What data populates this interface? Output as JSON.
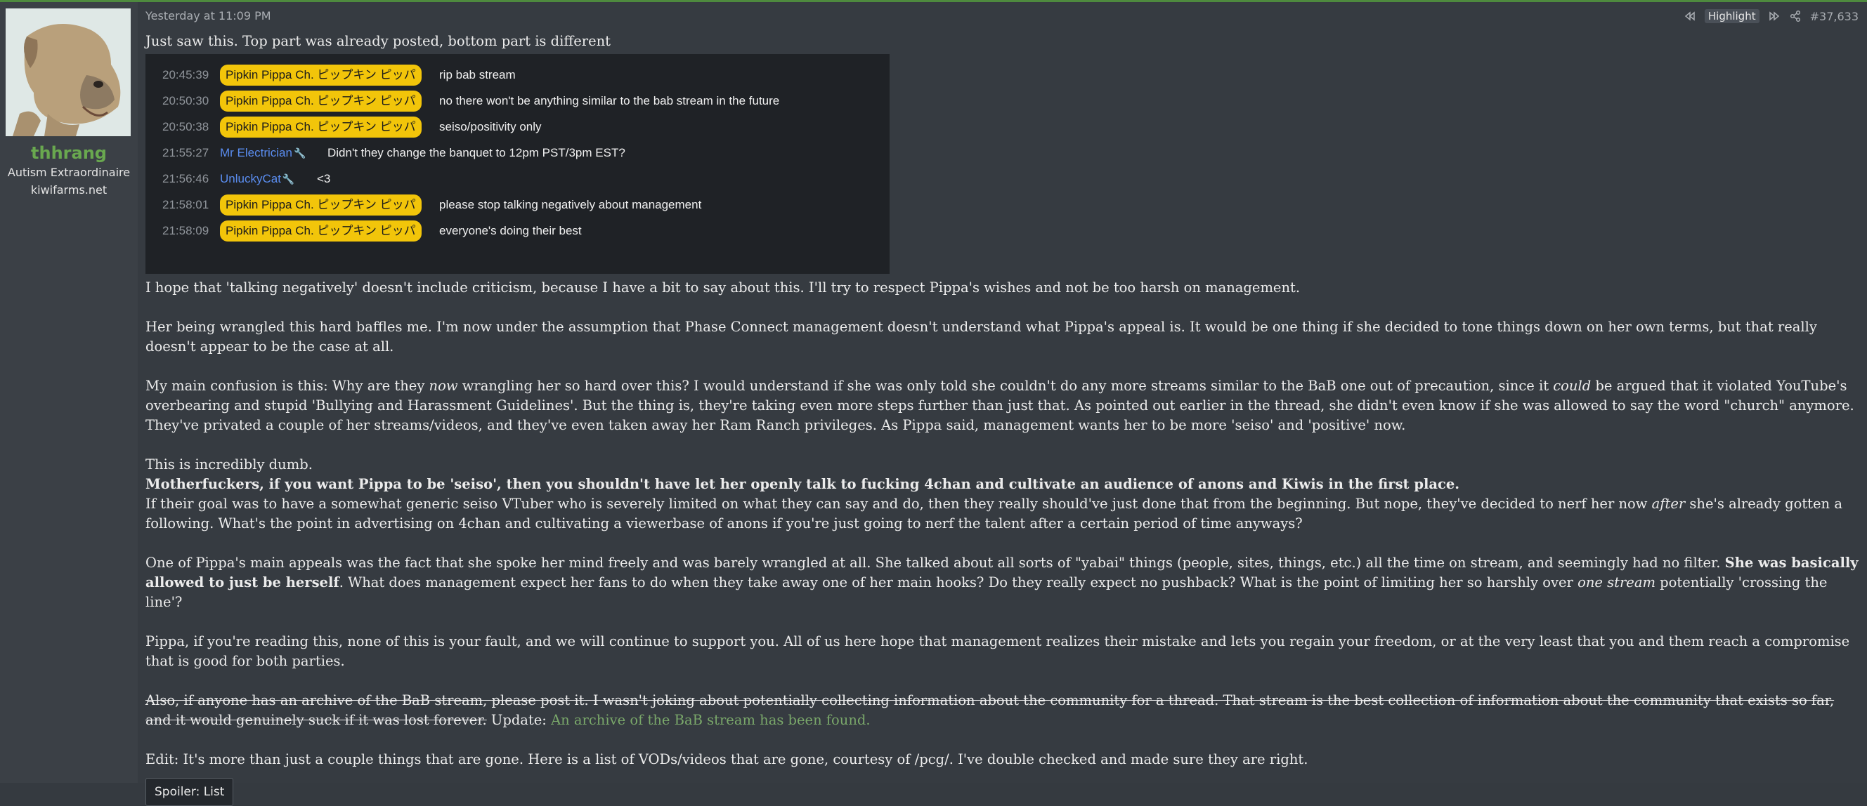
{
  "user": {
    "name": "thhrang",
    "title": "Autism Extraordinaire",
    "banner": "kiwifarms.net"
  },
  "post": {
    "date": "Yesterday at 11:09 PM",
    "highlight_label": "Highlight",
    "post_number": "#37,633",
    "intro": "Just saw this. Top part was already posted, bottom part is different",
    "chat": [
      {
        "time": "20:45:39",
        "name": "Pipkin Pippa Ch. ピップキン ピッパ",
        "badge": true,
        "message": "rip bab stream"
      },
      {
        "time": "20:50:30",
        "name": "Pipkin Pippa Ch. ピップキン ピッパ",
        "badge": true,
        "message": "no there won't be anything similar to the bab stream in the future"
      },
      {
        "time": "20:50:38",
        "name": "Pipkin Pippa Ch. ピップキン ピッパ",
        "badge": true,
        "message": "seiso/positivity only"
      },
      {
        "time": "21:55:27",
        "name": "Mr Electrician",
        "badge": false,
        "message": "Didn't they change the banquet to 12pm PST/3pm EST?"
      },
      {
        "time": "21:56:46",
        "name": "UnluckyCat",
        "badge": false,
        "message": "<3"
      },
      {
        "time": "21:58:01",
        "name": "Pipkin Pippa Ch. ピップキン ピッパ",
        "badge": true,
        "message": "please stop talking negatively about management"
      },
      {
        "time": "21:58:09",
        "name": "Pipkin Pippa Ch. ピップキン ピッパ",
        "badge": true,
        "message": "everyone's doing their best"
      }
    ],
    "p1": "I hope that 'talking negatively' doesn't include criticism, because I have a bit to say about this. I'll try to respect Pippa's wishes and not be too harsh on management.",
    "p2": "Her being wrangled this hard baffles me. I'm now under the assumption that Phase Connect management doesn't understand what Pippa's appeal is. It would be one thing if she decided to tone things down on her own terms, but that really doesn't appear to be the case at all.",
    "p3_a": "My main confusion is this: Why are they ",
    "p3_em1": "now",
    "p3_b": " wrangling her so hard over this? I would understand if she was only told she couldn't do any more streams similar to the BaB one out of precaution, since it ",
    "p3_em2": "could",
    "p3_c": " be argued that it violated YouTube's overbearing and stupid 'Bullying and Harassment Guidelines'. But the thing is, they're taking even more steps further than just that. As pointed out earlier in the thread, she didn't even know if she was allowed to say the word \"church\" anymore. They've privated a couple of her streams/videos, and they've even taken away her Ram Ranch privileges. As Pippa said, management wants her to be more 'seiso' and 'positive' now.",
    "p4": "This is incredibly dumb.",
    "p5_bold": "Motherfuckers, if you want Pippa to be 'seiso', then you shouldn't have let her openly talk to fucking 4chan and cultivate an audience of anons and Kiwis in the first place.",
    "p6_a": "If their goal was to have a somewhat generic seiso VTuber who is severely limited on what they can say and do, then they really should've just done that from the beginning. But nope, they've decided to nerf her now ",
    "p6_em": "after",
    "p6_b": " she's already gotten a following. What's the point in advertising on 4chan and cultivating a viewerbase of anons if you're just going to nerf the talent after a certain period of time anyways?",
    "p7_a": "One of Pippa's main appeals was the fact that she spoke her mind freely and was barely wrangled at all. She talked about all sorts of \"yabai\" things (people, sites, things, etc.) all the time on stream, and seemingly had no filter. ",
    "p7_bold": "She was basically allowed to just be herself",
    "p7_b": ". What does management expect her fans to do when they take away one of her main hooks? Do they really expect no pushback? What is the point of limiting her so harshly over ",
    "p7_em": "one stream",
    "p7_c": " potentially 'crossing the line'?",
    "p8": "Pippa, if you're reading this, none of this is your fault, and we will continue to support you. All of us here hope that management realizes their mistake and lets you regain your freedom, or at the very least that you and them reach a compromise that is good for both parties.",
    "p9_strike": "Also, if anyone has an archive of the BaB stream, please post it. I wasn't joking about potentially collecting information about the community for a thread. That stream is the best collection of information about the community that exists so far, and it would genuinely suck if it was lost forever.",
    "p9_update": " Update: ",
    "p9_link": "An archive of the BaB stream has been found.",
    "p10": "Edit: It's more than just a couple things that are gone. Here is a list of VODs/videos that are gone, courtesy of /pcg/. I've double checked and made sure they are right.",
    "spoiler_label": "Spoiler: List"
  },
  "colors": {
    "background": "#353a40",
    "username": "#69a84f",
    "badge": "#f2c50a",
    "chat_name": "#5a8df0",
    "link": "#7aa86a"
  }
}
